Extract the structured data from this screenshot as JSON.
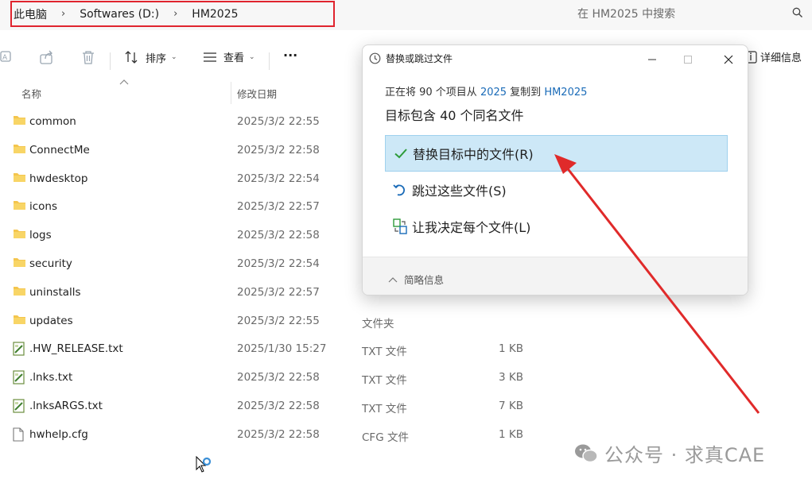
{
  "address": {
    "crumbs": [
      "此电脑",
      "Softwares (D:)",
      "HM2025"
    ],
    "separator": "›",
    "search_placeholder": "在 HM2025 中搜索"
  },
  "toolbar": {
    "sort_label": "排序",
    "view_label": "查看",
    "more_label": "···",
    "details_label": "详细信息"
  },
  "columns": {
    "name": "名称",
    "modified": "修改日期"
  },
  "files": [
    {
      "name": "common",
      "date": "2025/3/2 22:55",
      "type": "",
      "size": "",
      "icon": "folder-icon"
    },
    {
      "name": "ConnectMe",
      "date": "2025/3/2 22:58",
      "type": "",
      "size": "",
      "icon": "folder-icon"
    },
    {
      "name": "hwdesktop",
      "date": "2025/3/2 22:54",
      "type": "",
      "size": "",
      "icon": "folder-icon"
    },
    {
      "name": "icons",
      "date": "2025/3/2 22:57",
      "type": "",
      "size": "",
      "icon": "folder-icon"
    },
    {
      "name": "logs",
      "date": "2025/3/2 22:58",
      "type": "",
      "size": "",
      "icon": "folder-icon"
    },
    {
      "name": "security",
      "date": "2025/3/2 22:54",
      "type": "",
      "size": "",
      "icon": "folder-icon"
    },
    {
      "name": "uninstalls",
      "date": "2025/3/2 22:57",
      "type": "",
      "size": "",
      "icon": "folder-icon"
    },
    {
      "name": "updates",
      "date": "2025/3/2 22:55",
      "type": "文件夹",
      "size": "",
      "icon": "folder-icon"
    },
    {
      "name": ".HW_RELEASE.txt",
      "date": "2025/1/30 15:27",
      "type": "TXT 文件",
      "size": "1 KB",
      "icon": "text-file-icon"
    },
    {
      "name": ".lnks.txt",
      "date": "2025/3/2 22:58",
      "type": "TXT 文件",
      "size": "3 KB",
      "icon": "text-file-icon"
    },
    {
      "name": ".lnksARGS.txt",
      "date": "2025/3/2 22:58",
      "type": "TXT 文件",
      "size": "7 KB",
      "icon": "text-file-icon"
    },
    {
      "name": "hwhelp.cfg",
      "date": "2025/3/2 22:58",
      "type": "CFG 文件",
      "size": "1 KB",
      "icon": "file-icon"
    }
  ],
  "dialog": {
    "title": "替换或跳过文件",
    "copy_prefix": "正在将 90 个项目从 ",
    "copy_source": "2025",
    "copy_middle": " 复制到 ",
    "copy_dest": "HM2025",
    "conflict_text": "目标包含 40 个同名文件",
    "options": [
      {
        "label": "替换目标中的文件(R)",
        "icon": "checkmark-icon",
        "selected": true
      },
      {
        "label": "跳过这些文件(S)",
        "icon": "undo-icon",
        "selected": false
      },
      {
        "label": "让我决定每个文件(L)",
        "icon": "compare-icon",
        "selected": false
      }
    ],
    "footer_label": "简略信息"
  },
  "watermark": {
    "text": "公众号 · 求真CAE"
  },
  "colors": {
    "accent": "#1a6bb8",
    "selection_bg": "#cde8f7",
    "highlight_border": "#e0242e",
    "arrow": "#e02a2a"
  }
}
